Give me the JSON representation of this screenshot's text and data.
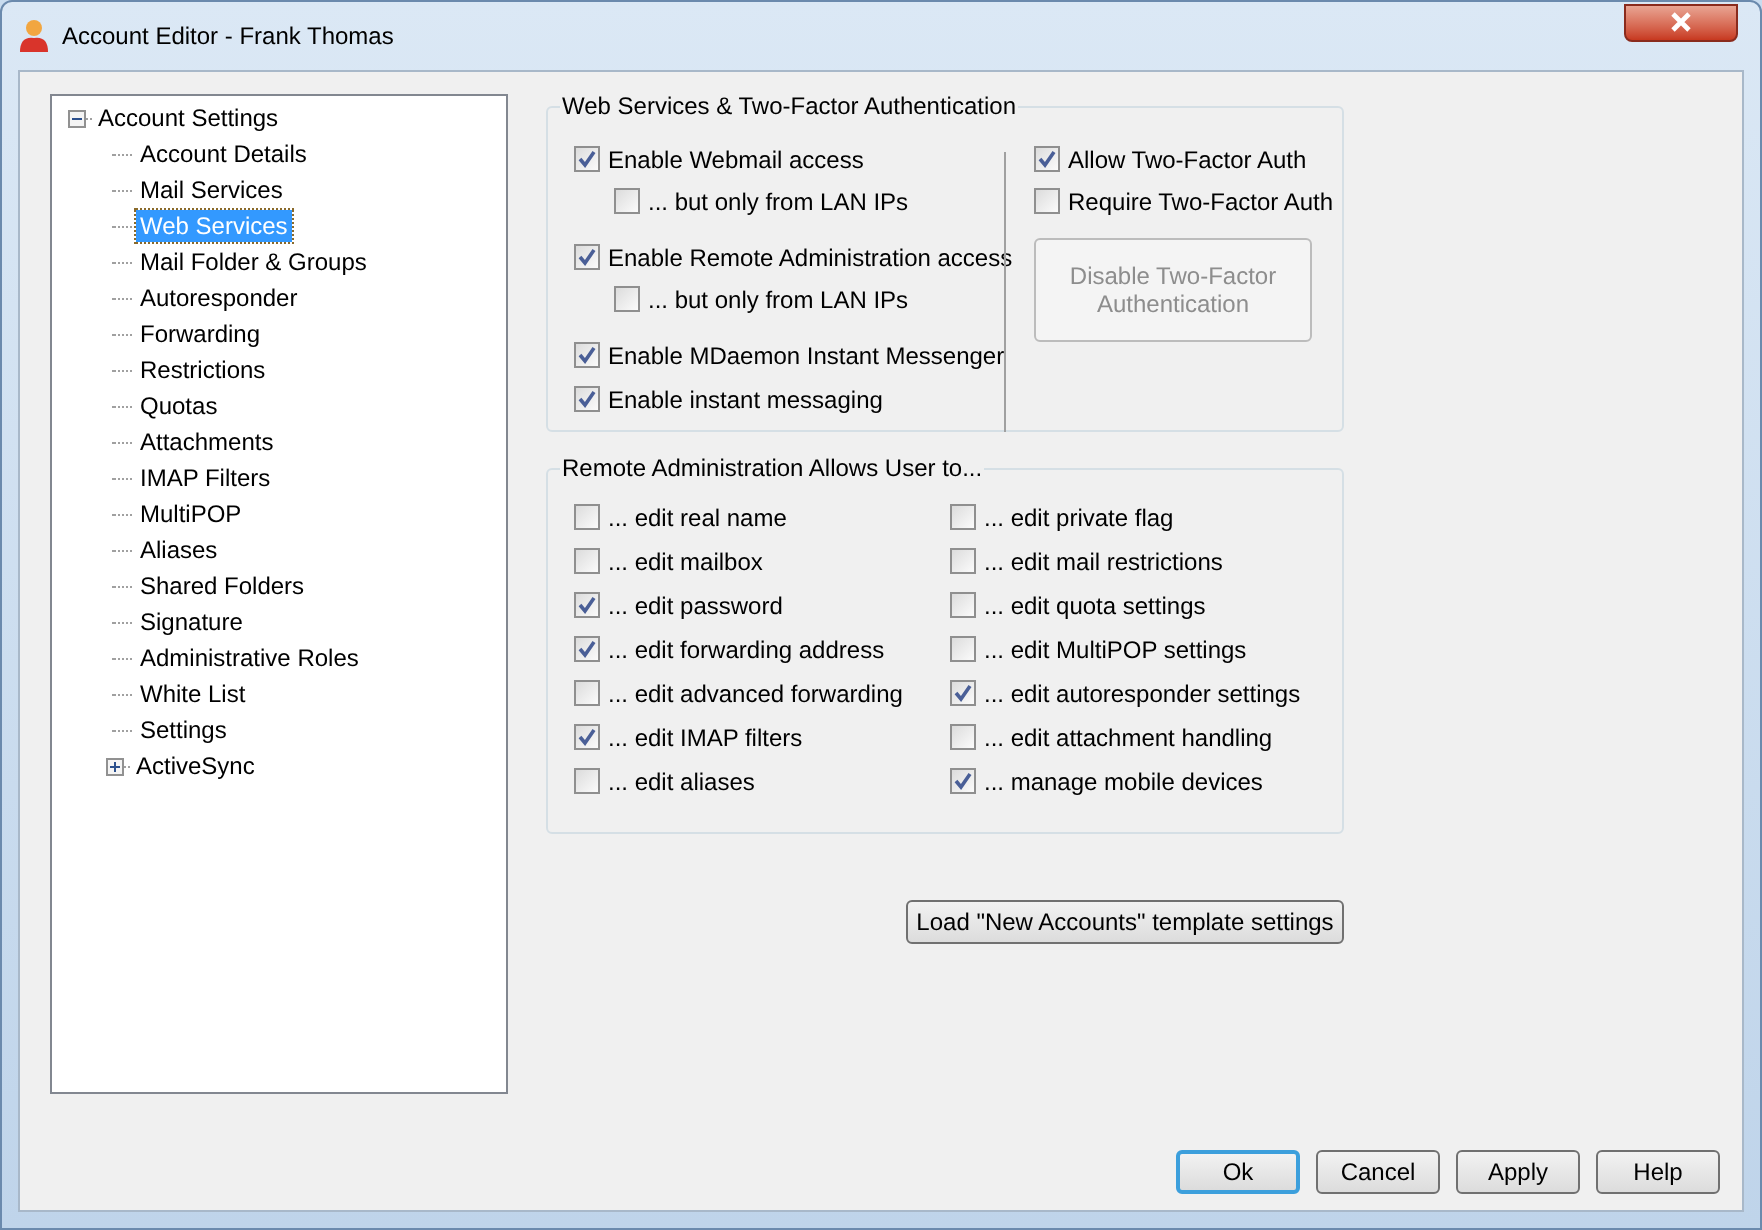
{
  "window": {
    "title": "Account Editor - Frank Thomas"
  },
  "tree": [
    {
      "label": "Account Settings",
      "selected": false,
      "expanded": true,
      "children": [
        {
          "label": "Account Details",
          "selected": false
        },
        {
          "label": "Mail Services",
          "selected": false
        },
        {
          "label": "Web Services",
          "selected": true
        },
        {
          "label": "Mail Folder & Groups",
          "selected": false
        },
        {
          "label": "Autoresponder",
          "selected": false
        },
        {
          "label": "Forwarding",
          "selected": false
        },
        {
          "label": "Restrictions",
          "selected": false
        },
        {
          "label": "Quotas",
          "selected": false
        },
        {
          "label": "Attachments",
          "selected": false
        },
        {
          "label": "IMAP Filters",
          "selected": false
        },
        {
          "label": "MultiPOP",
          "selected": false
        },
        {
          "label": "Aliases",
          "selected": false
        },
        {
          "label": "Shared Folders",
          "selected": false
        },
        {
          "label": "Signature",
          "selected": false
        },
        {
          "label": "Administrative Roles",
          "selected": false
        },
        {
          "label": "White List",
          "selected": false
        },
        {
          "label": "Settings",
          "selected": false
        },
        {
          "label": "ActiveSync",
          "selected": false,
          "expanded": false
        }
      ]
    }
  ],
  "web_services": {
    "title": "Web Services & Two-Factor Authentication",
    "options": [
      {
        "label": "Enable Webmail access",
        "checked": true,
        "children": [
          {
            "label": "... but only from LAN IPs",
            "checked": false
          }
        ]
      },
      {
        "label": "Enable Remote Administration access",
        "checked": true,
        "children": [
          {
            "label": "... but only from LAN IPs",
            "checked": false
          }
        ]
      },
      {
        "label": "Enable MDaemon Instant Messenger",
        "checked": true
      },
      {
        "label": "Enable instant messaging",
        "checked": true
      }
    ],
    "two_factor": [
      {
        "label": "Allow Two-Factor Auth",
        "checked": true
      },
      {
        "label": "Require Two-Factor Auth",
        "checked": false
      }
    ],
    "disable_button": {
      "label": "Disable Two-Factor Authentication",
      "disabled": true
    }
  },
  "remote_admin": {
    "title": "Remote Administration Allows User to...",
    "left": [
      {
        "label": "... edit real name",
        "checked": false
      },
      {
        "label": "... edit mailbox",
        "checked": false
      },
      {
        "label": "... edit password",
        "checked": true
      },
      {
        "label": "... edit forwarding address",
        "checked": true
      },
      {
        "label": "... edit advanced forwarding",
        "checked": false
      },
      {
        "label": "... edit IMAP filters",
        "checked": true
      },
      {
        "label": "... edit aliases",
        "checked": false
      }
    ],
    "right": [
      {
        "label": "... edit private flag",
        "checked": false
      },
      {
        "label": "... edit mail restrictions",
        "checked": false
      },
      {
        "label": "... edit quota settings",
        "checked": false
      },
      {
        "label": "... edit MultiPOP settings",
        "checked": false
      },
      {
        "label": "... edit autoresponder settings",
        "checked": true
      },
      {
        "label": "... edit attachment handling",
        "checked": false
      },
      {
        "label": "... manage mobile devices",
        "checked": true
      }
    ]
  },
  "template_button": "Load \"New Accounts\" template settings",
  "buttons": [
    {
      "label": "Ok",
      "selected": true
    },
    {
      "label": "Cancel",
      "selected": false
    },
    {
      "label": "Apply",
      "selected": false
    },
    {
      "label": "Help",
      "selected": false
    }
  ]
}
